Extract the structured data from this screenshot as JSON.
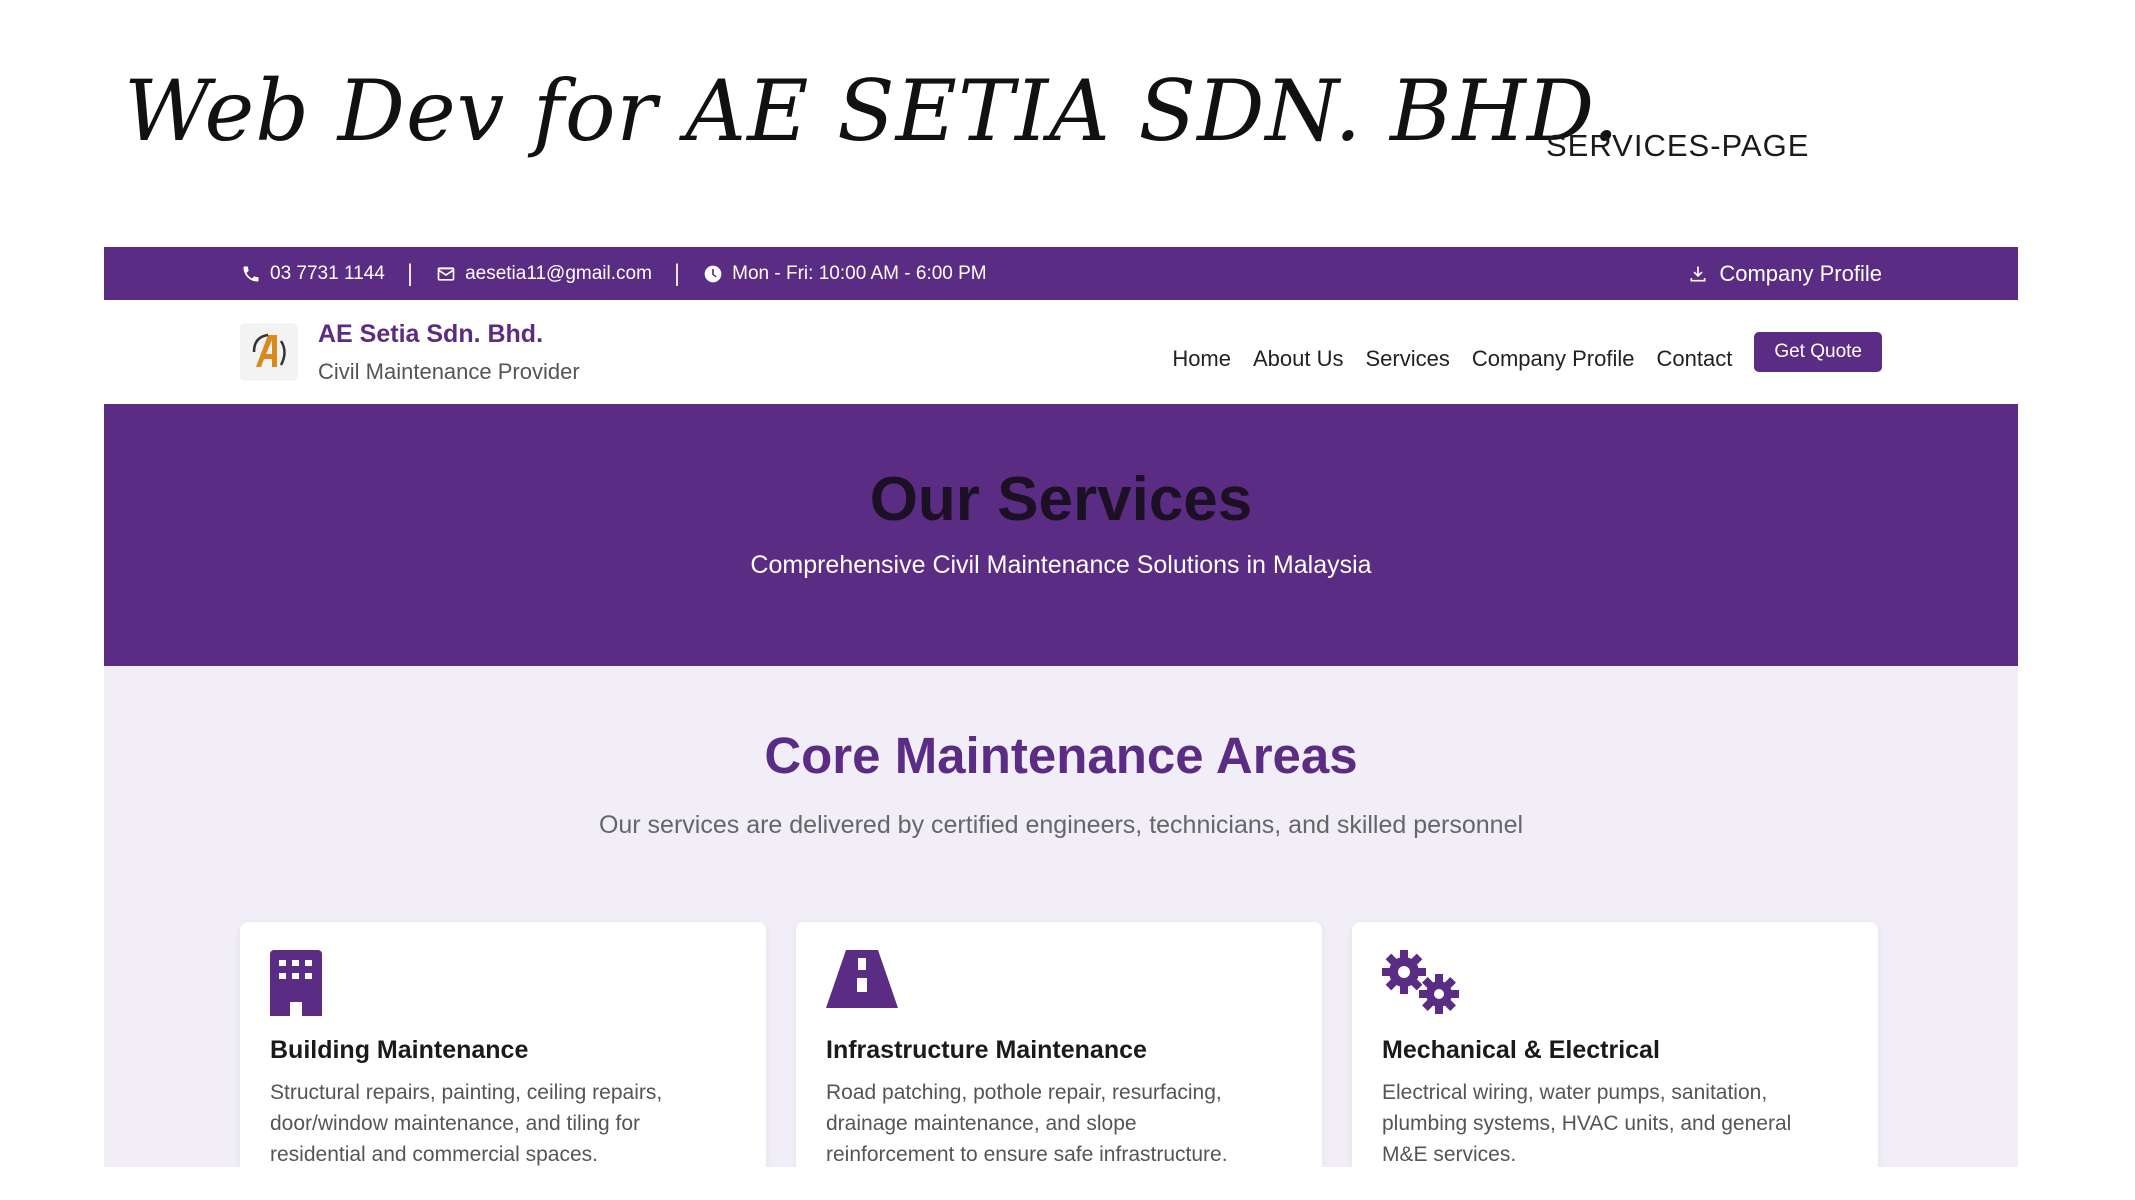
{
  "slide": {
    "title": "Web Dev for AE SETIA SDN. BHD.",
    "tag": "SERVICES-PAGE"
  },
  "topbar": {
    "phone": "03 7731 1144",
    "email": "aesetia11@gmail.com",
    "hours": "Mon - Fri: 10:00 AM - 6:00 PM",
    "separator": "|",
    "company_profile": "Company Profile"
  },
  "brand": {
    "name": "AE Setia Sdn. Bhd.",
    "tagline": "Civil Maintenance Provider"
  },
  "nav": {
    "items": [
      "Home",
      "About Us",
      "Services",
      "Company Profile",
      "Contact"
    ],
    "cta": "Get Quote"
  },
  "hero": {
    "title": "Our Services",
    "subtitle": "Comprehensive Civil Maintenance Solutions in Malaysia"
  },
  "core": {
    "title": "Core Maintenance Areas",
    "subtitle": "Our services are delivered by certified engineers, technicians, and skilled personnel"
  },
  "cards": [
    {
      "icon": "building-icon",
      "title": "Building Maintenance",
      "desc_lines": [
        "Structural repairs, painting, ceiling repairs,",
        "door/window maintenance, and tiling for",
        "residential and commercial spaces."
      ]
    },
    {
      "icon": "road-icon",
      "title": "Infrastructure Maintenance",
      "desc_lines": [
        "Road patching, pothole repair, resurfacing,",
        "drainage maintenance, and slope",
        "reinforcement to ensure safe infrastructure."
      ]
    },
    {
      "icon": "gears-icon",
      "title": "Mechanical & Electrical",
      "desc_lines": [
        "Electrical wiring, water pumps, sanitation,",
        "plumbing systems, HVAC units, and general",
        "M&E services."
      ]
    }
  ],
  "colors": {
    "brand_purple": "#5b2c83",
    "page_bg": "#f1eef8"
  }
}
